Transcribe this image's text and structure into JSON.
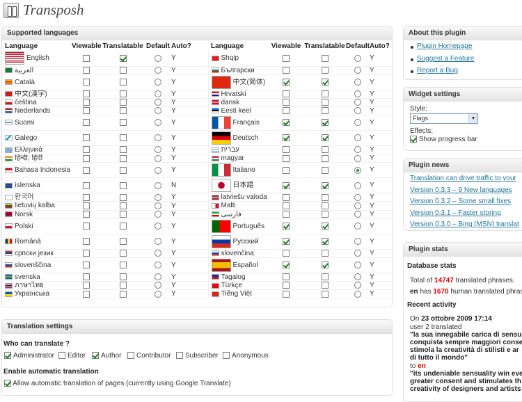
{
  "app": {
    "title": "Transposh"
  },
  "languages_box": {
    "title": "Supported languages",
    "headers": [
      "Language",
      "Viewable",
      "Translatable",
      "Default",
      "Auto?"
    ]
  },
  "languages": [
    {
      "name": "English",
      "flag": "us",
      "big": true,
      "viewable": false,
      "translatable": true,
      "default": false,
      "auto": "Y"
    },
    {
      "name": "العربية",
      "flag": "sa",
      "big": false,
      "viewable": false,
      "translatable": false,
      "default": false,
      "auto": "Y"
    },
    {
      "name": "Català",
      "flag": "ct",
      "big": false,
      "viewable": false,
      "translatable": false,
      "default": false,
      "auto": "Y"
    },
    {
      "name": "中文(漢字)",
      "flag": "tw",
      "big": false,
      "viewable": false,
      "translatable": false,
      "default": false,
      "auto": "Y"
    },
    {
      "name": "čeština",
      "flag": "cz",
      "big": false,
      "viewable": false,
      "translatable": false,
      "default": false,
      "auto": "Y"
    },
    {
      "name": "Nederlands",
      "flag": "nl",
      "big": false,
      "viewable": false,
      "translatable": false,
      "default": false,
      "auto": "Y"
    },
    {
      "name": "Suomi",
      "flag": "fi",
      "big": false,
      "viewable": false,
      "translatable": false,
      "default": false,
      "auto": "Y"
    },
    {
      "name": "Galego",
      "flag": "gl",
      "big": false,
      "viewable": false,
      "translatable": false,
      "default": false,
      "auto": "Y"
    },
    {
      "name": "Ελληνικά",
      "flag": "gr",
      "big": false,
      "viewable": false,
      "translatable": false,
      "default": false,
      "auto": "Y"
    },
    {
      "name": "हिन्दी; हिंदी",
      "flag": "in",
      "big": false,
      "viewable": false,
      "translatable": false,
      "default": false,
      "auto": "Y"
    },
    {
      "name": "Bahasa Indonesia",
      "flag": "id",
      "big": false,
      "viewable": false,
      "translatable": false,
      "default": false,
      "auto": "Y"
    },
    {
      "name": "íslenska",
      "flag": "is",
      "big": false,
      "viewable": false,
      "translatable": false,
      "default": false,
      "auto": "N"
    },
    {
      "name": "한국어",
      "flag": "kr",
      "big": false,
      "viewable": false,
      "translatable": false,
      "default": false,
      "auto": "Y"
    },
    {
      "name": "lietuvių kalba",
      "flag": "lt",
      "big": false,
      "viewable": false,
      "translatable": false,
      "default": false,
      "auto": "Y"
    },
    {
      "name": "Norsk",
      "flag": "no",
      "big": false,
      "viewable": false,
      "translatable": false,
      "default": false,
      "auto": "Y"
    },
    {
      "name": "Polski",
      "flag": "pl",
      "big": false,
      "viewable": false,
      "translatable": false,
      "default": false,
      "auto": "Y"
    },
    {
      "name": "Română",
      "flag": "ro",
      "big": false,
      "viewable": false,
      "translatable": false,
      "default": false,
      "auto": "Y"
    },
    {
      "name": "српски језик",
      "flag": "rs",
      "big": false,
      "viewable": false,
      "translatable": false,
      "default": false,
      "auto": "Y"
    },
    {
      "name": "slovenščina",
      "flag": "si",
      "big": false,
      "viewable": false,
      "translatable": false,
      "default": false,
      "auto": "Y"
    },
    {
      "name": "svenska",
      "flag": "se",
      "big": false,
      "viewable": false,
      "translatable": false,
      "default": false,
      "auto": "Y"
    },
    {
      "name": "ภาษาไทย",
      "flag": "th",
      "big": false,
      "viewable": false,
      "translatable": false,
      "default": false,
      "auto": "Y"
    },
    {
      "name": "Українська",
      "flag": "ua",
      "big": false,
      "viewable": false,
      "translatable": false,
      "default": false,
      "auto": "Y"
    }
  ],
  "languages_right": [
    {
      "name": "Shqip",
      "flag": "al",
      "big": false,
      "viewable": false,
      "translatable": false,
      "default": false,
      "auto": "Y"
    },
    {
      "name": "Български",
      "flag": "bg",
      "big": false,
      "viewable": false,
      "translatable": false,
      "default": false,
      "auto": "Y"
    },
    {
      "name": "中文(简体)",
      "flag": "cn",
      "big": true,
      "viewable": true,
      "translatable": true,
      "default": false,
      "auto": "Y"
    },
    {
      "name": "Hrvatski",
      "flag": "hr",
      "big": false,
      "viewable": false,
      "translatable": false,
      "default": false,
      "auto": "Y"
    },
    {
      "name": "dansk",
      "flag": "dk",
      "big": false,
      "viewable": false,
      "translatable": false,
      "default": false,
      "auto": "Y"
    },
    {
      "name": "Eesti keel",
      "flag": "ee",
      "big": false,
      "viewable": false,
      "translatable": false,
      "default": false,
      "auto": "Y"
    },
    {
      "name": "Français",
      "flag": "fr",
      "big": true,
      "viewable": true,
      "translatable": true,
      "default": false,
      "auto": "Y"
    },
    {
      "name": "Deutsch",
      "flag": "de",
      "big": true,
      "viewable": true,
      "translatable": true,
      "default": false,
      "auto": "Y"
    },
    {
      "name": "עברית",
      "flag": "il",
      "big": false,
      "viewable": false,
      "translatable": false,
      "default": false,
      "auto": "Y"
    },
    {
      "name": "magyar",
      "flag": "hu",
      "big": false,
      "viewable": false,
      "translatable": false,
      "default": false,
      "auto": "Y"
    },
    {
      "name": "Italiano",
      "flag": "it",
      "big": true,
      "viewable": false,
      "translatable": false,
      "default": true,
      "auto": "Y"
    },
    {
      "name": "日本語",
      "flag": "jp",
      "big": true,
      "viewable": true,
      "translatable": true,
      "default": false,
      "auto": "Y"
    },
    {
      "name": "latviešu valoda",
      "flag": "lv",
      "big": false,
      "viewable": false,
      "translatable": false,
      "default": false,
      "auto": "Y"
    },
    {
      "name": "Malti",
      "flag": "mt",
      "big": false,
      "viewable": false,
      "translatable": false,
      "default": false,
      "auto": "Y"
    },
    {
      "name": "فارسی",
      "flag": "ir",
      "big": false,
      "viewable": false,
      "translatable": false,
      "default": false,
      "auto": "Y"
    },
    {
      "name": "Português",
      "flag": "pt",
      "big": true,
      "viewable": true,
      "translatable": true,
      "default": false,
      "auto": "Y"
    },
    {
      "name": "Русский",
      "flag": "ru",
      "big": true,
      "viewable": true,
      "translatable": true,
      "default": false,
      "auto": "Y"
    },
    {
      "name": "slovenčina",
      "flag": "sk",
      "big": false,
      "viewable": false,
      "translatable": false,
      "default": false,
      "auto": "Y"
    },
    {
      "name": "Español",
      "flag": "es",
      "big": true,
      "viewable": true,
      "translatable": true,
      "default": false,
      "auto": "Y"
    },
    {
      "name": "Tagalog",
      "flag": "ph",
      "big": false,
      "viewable": false,
      "translatable": false,
      "default": false,
      "auto": "Y"
    },
    {
      "name": "Türkçe",
      "flag": "tr",
      "big": false,
      "viewable": false,
      "translatable": false,
      "default": false,
      "auto": "Y"
    },
    {
      "name": "Tiếng Việt",
      "flag": "vn",
      "big": false,
      "viewable": false,
      "translatable": false,
      "default": false,
      "auto": "Y"
    }
  ],
  "translation_settings": {
    "title": "Translation settings",
    "who_label": "Who can translate ?",
    "roles": [
      {
        "label": "Administrator",
        "checked": true
      },
      {
        "label": "Editor",
        "checked": false
      },
      {
        "label": "Author",
        "checked": true
      },
      {
        "label": "Contributor",
        "checked": false
      },
      {
        "label": "Subscriber",
        "checked": false
      },
      {
        "label": "Anonymous",
        "checked": false
      }
    ],
    "auto_label": "Enable automatic translation",
    "auto_option": "Allow automatic translation of pages (currently using Google Translate)",
    "auto_checked": true
  },
  "about": {
    "title": "About this plugin",
    "links": [
      "Plugin Homepage",
      "Suggest a Feature",
      "Report a Bug"
    ]
  },
  "widget": {
    "title": "Widget settings",
    "style_label": "Style:",
    "style_value": "Flags",
    "effects_label": "Effects:",
    "progress_label": "Show progress bar",
    "progress_checked": true
  },
  "news": {
    "title": "Plugin news",
    "items": [
      "Translation can drive traffic to your",
      "Version 0.3.3 – 9 New languages",
      "Version 0.3.2 – Some small fixes",
      "Version 0.3.1 – Faster storing",
      "Version 0.3.0 – Bing (MSN) translat"
    ]
  },
  "stats": {
    "title": "Plugin stats",
    "db_title": "Database stats",
    "total_prefix": "Total of ",
    "total_count": "14747",
    "total_suffix": " translated phrases.",
    "en_code": "en",
    "en_mid": " has ",
    "en_count": "1670",
    "en_suffix": " human translated phrase",
    "activity_title": "Recent activity",
    "on_prefix": "On ",
    "on_date": "23 ottobre 2009 17:14",
    "user_line_prefix": "user ",
    "user_count": "2",
    "user_line_suffix": " translated",
    "quote1": "\"la sua innegabile carica di sensua",
    "quote1b": "conquista sempre maggiori conse",
    "quote1c": "stimola la creatività di stilisti e ar",
    "quote1d": "di tutto il mondo\"",
    "to_prefix": "to ",
    "to_lang": "en",
    "quote2": "\"its undeniable sensuality win eve",
    "quote2b": "greater consent and stimulates th",
    "quote2c": "creativity of designers and artists"
  },
  "colors": {
    "link": "#21759b",
    "count_red": "#dd0000",
    "check_green": "#1b7a1b"
  }
}
